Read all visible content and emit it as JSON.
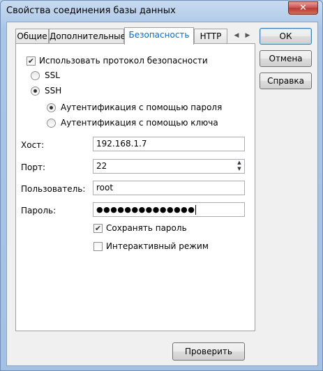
{
  "window": {
    "title": "Свойства соединения базы данных",
    "close_icon": "close-icon"
  },
  "tabs": [
    {
      "label": "Общие",
      "active": false
    },
    {
      "label": "Дополнительные",
      "active": false
    },
    {
      "label": "Безопасность",
      "active": true
    },
    {
      "label": "HTTP",
      "active": false
    }
  ],
  "tab_scroll": {
    "left": "◀",
    "right": "▶"
  },
  "security": {
    "use_protocol_label": "Использовать протокол безопасности",
    "use_protocol_checked": true,
    "ssl_label": "SSL",
    "ssh_label": "SSH",
    "ssh_selected": true,
    "auth_password_label": "Аутентификация с помощью пароля",
    "auth_key_label": "Аутентификация с помощью ключа",
    "auth_password_selected": true
  },
  "fields": {
    "host_label": "Хост:",
    "host_value": "192.168.1.7",
    "port_label": "Порт:",
    "port_value": "22",
    "user_label": "Пользователь:",
    "user_value": "root",
    "password_label": "Пароль:",
    "password_mask": "●●●●●●●●●●●●●●"
  },
  "options": {
    "save_password_label": "Сохранять пароль",
    "save_password_checked": true,
    "interactive_label": "Интерактивный режим",
    "interactive_checked": false
  },
  "buttons": {
    "ok": "ОК",
    "cancel": "Отмена",
    "help": "Справка",
    "test": "Проверить"
  }
}
